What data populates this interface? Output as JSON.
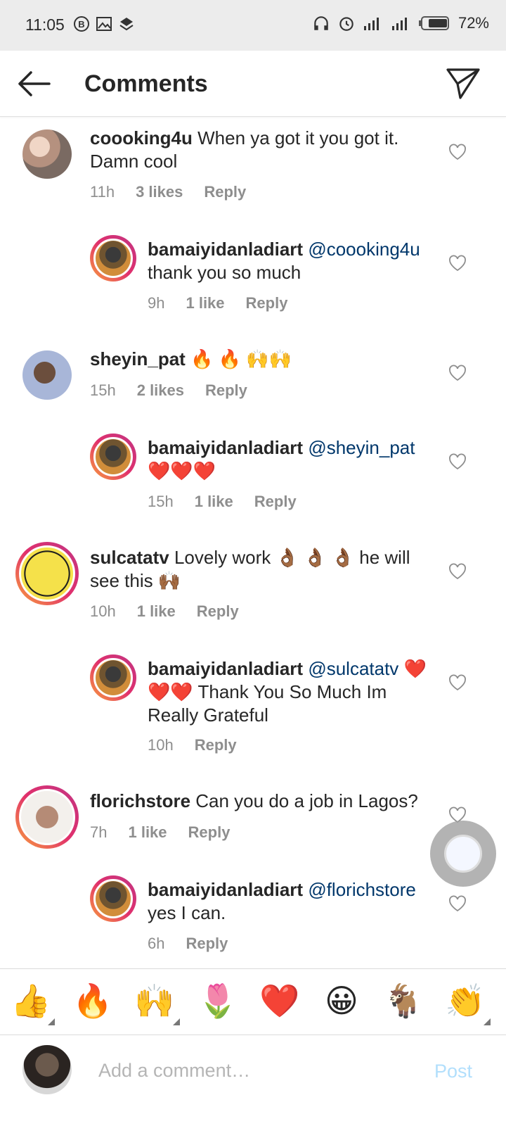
{
  "status": {
    "time": "11:05",
    "battery": "72%"
  },
  "header": {
    "title": "Comments"
  },
  "reply_label": "Reply",
  "comments": [
    {
      "user": "coooking4u",
      "text": "When ya got it you got it. Damn cool",
      "time": "11h",
      "likes": "3 likes"
    },
    {
      "user": "bamaiyidanladiart",
      "mention": "@coooking4u",
      "text": "thank you so much",
      "time": "9h",
      "likes": "1 like"
    },
    {
      "user": "sheyin_pat",
      "text": "🔥 🔥 🙌🙌",
      "time": "15h",
      "likes": "2 likes"
    },
    {
      "user": "bamaiyidanladiart",
      "mention": "@sheyin_pat",
      "text": "❤️❤️❤️",
      "time": "15h",
      "likes": "1 like"
    },
    {
      "user": "sulcatatv",
      "text": "Lovely work 👌🏾 👌🏾 👌🏾 he will see this 🙌🏾",
      "time": "10h",
      "likes": "1 like"
    },
    {
      "user": "bamaiyidanladiart",
      "mention": "@sulcatatv",
      "text": "❤️❤️❤️ Thank You So Much Im Really Grateful",
      "time": "10h",
      "likes": ""
    },
    {
      "user": "florichstore",
      "text": "Can you do a job in Lagos?",
      "time": "7h",
      "likes": "1 like"
    },
    {
      "user": "bamaiyidanladiart",
      "mention": "@florichstore",
      "text": "yes I can.",
      "time": "6h",
      "likes": ""
    }
  ],
  "emoji_bar": [
    "👍",
    "🔥",
    "🙌",
    "🌷",
    "❤️",
    "😀",
    "🐐",
    "👏"
  ],
  "input": {
    "placeholder": "Add a comment…",
    "post_label": "Post"
  },
  "colors": {
    "mention": "#00376b",
    "post_disabled": "#b2dffc",
    "meta": "#8e8e8e"
  }
}
